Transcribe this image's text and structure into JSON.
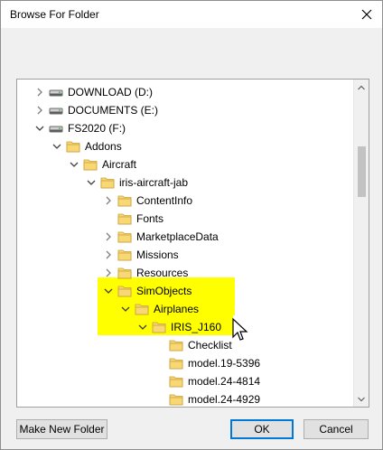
{
  "window": {
    "title": "Browse For Folder"
  },
  "tree": {
    "rows": [
      {
        "label": "DOWNLOAD (D:)",
        "icon": "drive-icon",
        "expanded": false,
        "has_children": true
      },
      {
        "label": "DOCUMENTS (E:)",
        "icon": "drive-icon",
        "expanded": false,
        "has_children": true
      },
      {
        "label": "FS2020 (F:)",
        "icon": "drive-icon",
        "expanded": true,
        "has_children": true
      },
      {
        "label": "Addons",
        "icon": "folder-icon",
        "expanded": true,
        "has_children": true
      },
      {
        "label": "Aircraft",
        "icon": "folder-icon",
        "expanded": true,
        "has_children": true
      },
      {
        "label": "iris-aircraft-jab",
        "icon": "folder-icon",
        "expanded": true,
        "has_children": true
      },
      {
        "label": "ContentInfo",
        "icon": "folder-icon",
        "expanded": false,
        "has_children": true
      },
      {
        "label": "Fonts",
        "icon": "folder-icon",
        "expanded": false,
        "has_children": false
      },
      {
        "label": "MarketplaceData",
        "icon": "folder-icon",
        "expanded": false,
        "has_children": true
      },
      {
        "label": "Missions",
        "icon": "folder-icon",
        "expanded": false,
        "has_children": true
      },
      {
        "label": "Resources",
        "icon": "folder-icon",
        "expanded": false,
        "has_children": true
      },
      {
        "label": "SimObjects",
        "icon": "folder-icon",
        "expanded": true,
        "has_children": true
      },
      {
        "label": "Airplanes",
        "icon": "folder-icon",
        "expanded": true,
        "has_children": true
      },
      {
        "label": "IRIS_J160",
        "icon": "folder-icon",
        "expanded": true,
        "has_children": true
      },
      {
        "label": "Checklist",
        "icon": "folder-icon",
        "expanded": false,
        "has_children": false
      },
      {
        "label": "model.19-5396",
        "icon": "folder-icon",
        "expanded": false,
        "has_children": false
      },
      {
        "label": "model.24-4814",
        "icon": "folder-icon",
        "expanded": false,
        "has_children": false
      },
      {
        "label": "model.24-4929",
        "icon": "folder-icon",
        "expanded": false,
        "has_children": false
      }
    ]
  },
  "buttons": {
    "make_new_folder": "Make New Folder",
    "ok": "OK",
    "cancel": "Cancel"
  },
  "colors": {
    "highlight": "#ffff00",
    "folder": "#f8d775",
    "accent": "#0078d7"
  }
}
